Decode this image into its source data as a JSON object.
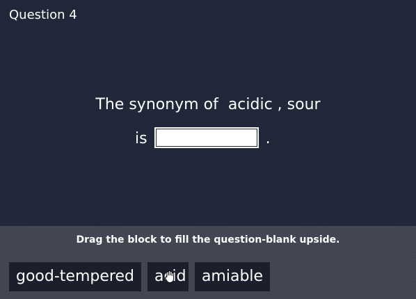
{
  "question": {
    "number_label": "Question 4",
    "line1_prefix": "The synonym of",
    "keyword": "acidic , sour",
    "line2_prefix": "is",
    "blank_value": "",
    "line2_suffix": "."
  },
  "answer_area": {
    "instruction": "Drag the block to fill the question-blank upside.",
    "blocks": [
      {
        "label": "good-tempered"
      },
      {
        "label": "acid"
      },
      {
        "label": "amiable"
      }
    ]
  },
  "cursor_icon": "grab-hand-icon"
}
